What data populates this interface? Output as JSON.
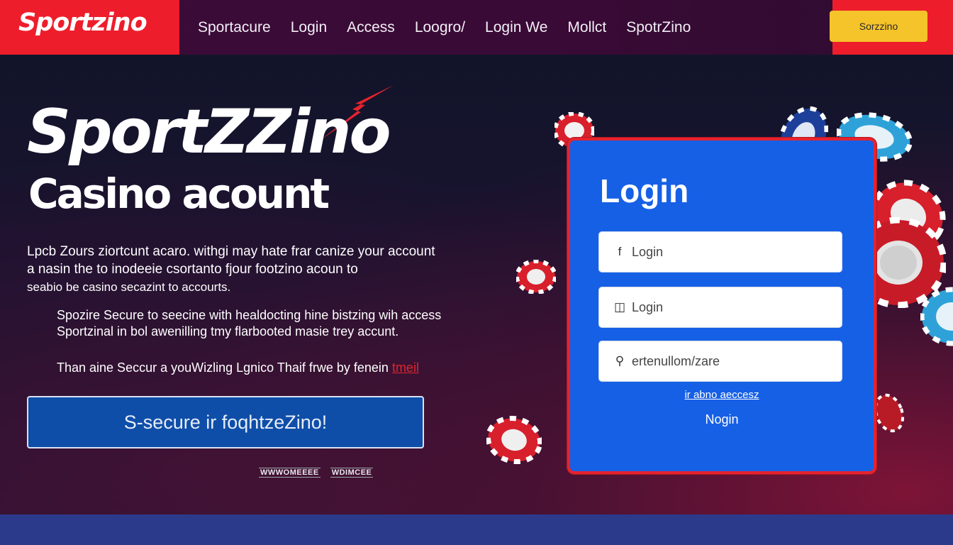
{
  "header": {
    "brand": "Sportzino",
    "nav": [
      "Sportacure",
      "Login",
      "Access",
      "Loogro/",
      "Login We",
      "Mollct",
      "SpotrZino"
    ],
    "cta_label": "Sorzzino"
  },
  "hero": {
    "title": "SportZZino",
    "subtitle": "Casino acount",
    "paragraph1": [
      "Lpcb Zours ziortcunt acaro. withgi may hate frar canize your account",
      "a nasin the to inodeeie csortanto fjour footzino acoun to",
      "seabio be casino secazint to accourts."
    ],
    "paragraph2": [
      "Spozire Secure to seecine with healdocting hine bistzing wih access",
      "Sportzinal in bol awenilling tmy flarbooted masie trey accunt."
    ],
    "paragraph3": "Than aine Seccur a youWizling Lgnico Thaif frwe by fenein",
    "paragraph3_link": "tmeil",
    "cta_label": "S-secure ir foqhtzeZino!",
    "footer_logos": [
      "WWWOMEEEE",
      "WDIMCEE"
    ]
  },
  "login_card": {
    "title": "Login",
    "fields": [
      {
        "icon": "f",
        "placeholder": "Login"
      },
      {
        "icon": "◫",
        "placeholder": "Login"
      },
      {
        "icon": "⚲",
        "placeholder": "ertenullom/zare"
      }
    ],
    "link": "ir abno aeccesz",
    "submit": "Nogin"
  },
  "colors": {
    "brand_red": "#ee1d2b",
    "header_bg": "#3a0a36",
    "hero_bg": "#161328",
    "card_blue": "#1660e6",
    "cta_blue": "#0f4ea8",
    "header_button": "#f5c32a",
    "footer_band": "#2c3a8c"
  }
}
